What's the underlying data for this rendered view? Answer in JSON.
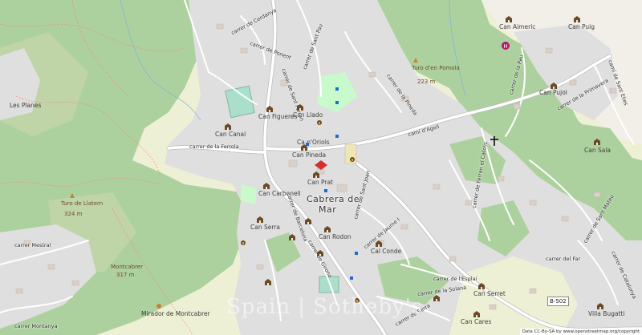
{
  "map": {
    "town_name": [
      "Cabrera de",
      "Mar"
    ],
    "attribution": "Data CC-By-SA by www.openstreetmap.org/copyright",
    "watermark": "Spain | Sotheby's",
    "road_ref": "B-502",
    "places": [
      "Can Aimeric",
      "Can Puig",
      "Can Pujol",
      "Can Sala",
      "Can Llado",
      "Can Figueres",
      "Can Canal",
      "Can Pineda",
      "Ca n'Oriols",
      "Can Prat",
      "Can Carbonell",
      "Can Serra",
      "Can Rodon",
      "Cal Conde",
      "Can Serret",
      "Can Cares",
      "Villa Bugatti",
      "Les Planes",
      "Mirador de Montcabrer"
    ],
    "peaks": [
      {
        "name": "Turo d'en Pomola",
        "elevation": "223 m"
      },
      {
        "name": "Turo de Llatern",
        "elevation": "324 m"
      },
      {
        "name": "Montcabrer",
        "elevation": "317 m"
      }
    ],
    "streets": [
      "carrer de Cerdanya",
      "carrer de Sant Pau",
      "carrer de Ponent",
      "carrer de Sant Ferran",
      "carrer de la Pineda",
      "camí d'Agell",
      "carrer de la Ferrola",
      "carrer de Sant Joan",
      "carrer de Barcelona",
      "carrer de Jaume I",
      "carrer Mestral",
      "carrer Montanya",
      "carrer de Girona",
      "carrer de l'Esplai",
      "carrer de la Solana",
      "carrer de Serra",
      "carrer de Sant Mateu",
      "carrer de Ferran el Catolic",
      "carrer de la Pau",
      "carrer de la Primavera",
      "camí de Sant Elies",
      "carrer del Far",
      "carrer de Catalunya"
    ],
    "icons": [
      "hospital-icon",
      "church-cross-icon",
      "mansion-icon",
      "info-icon",
      "viewpoint-icon"
    ],
    "colors": {
      "forest": "#add19e",
      "residential": "#e0dfdf",
      "park": "#c8facc",
      "pitch": "#aae0cb",
      "road": "#ffffff",
      "background": "#eef0d5"
    }
  }
}
